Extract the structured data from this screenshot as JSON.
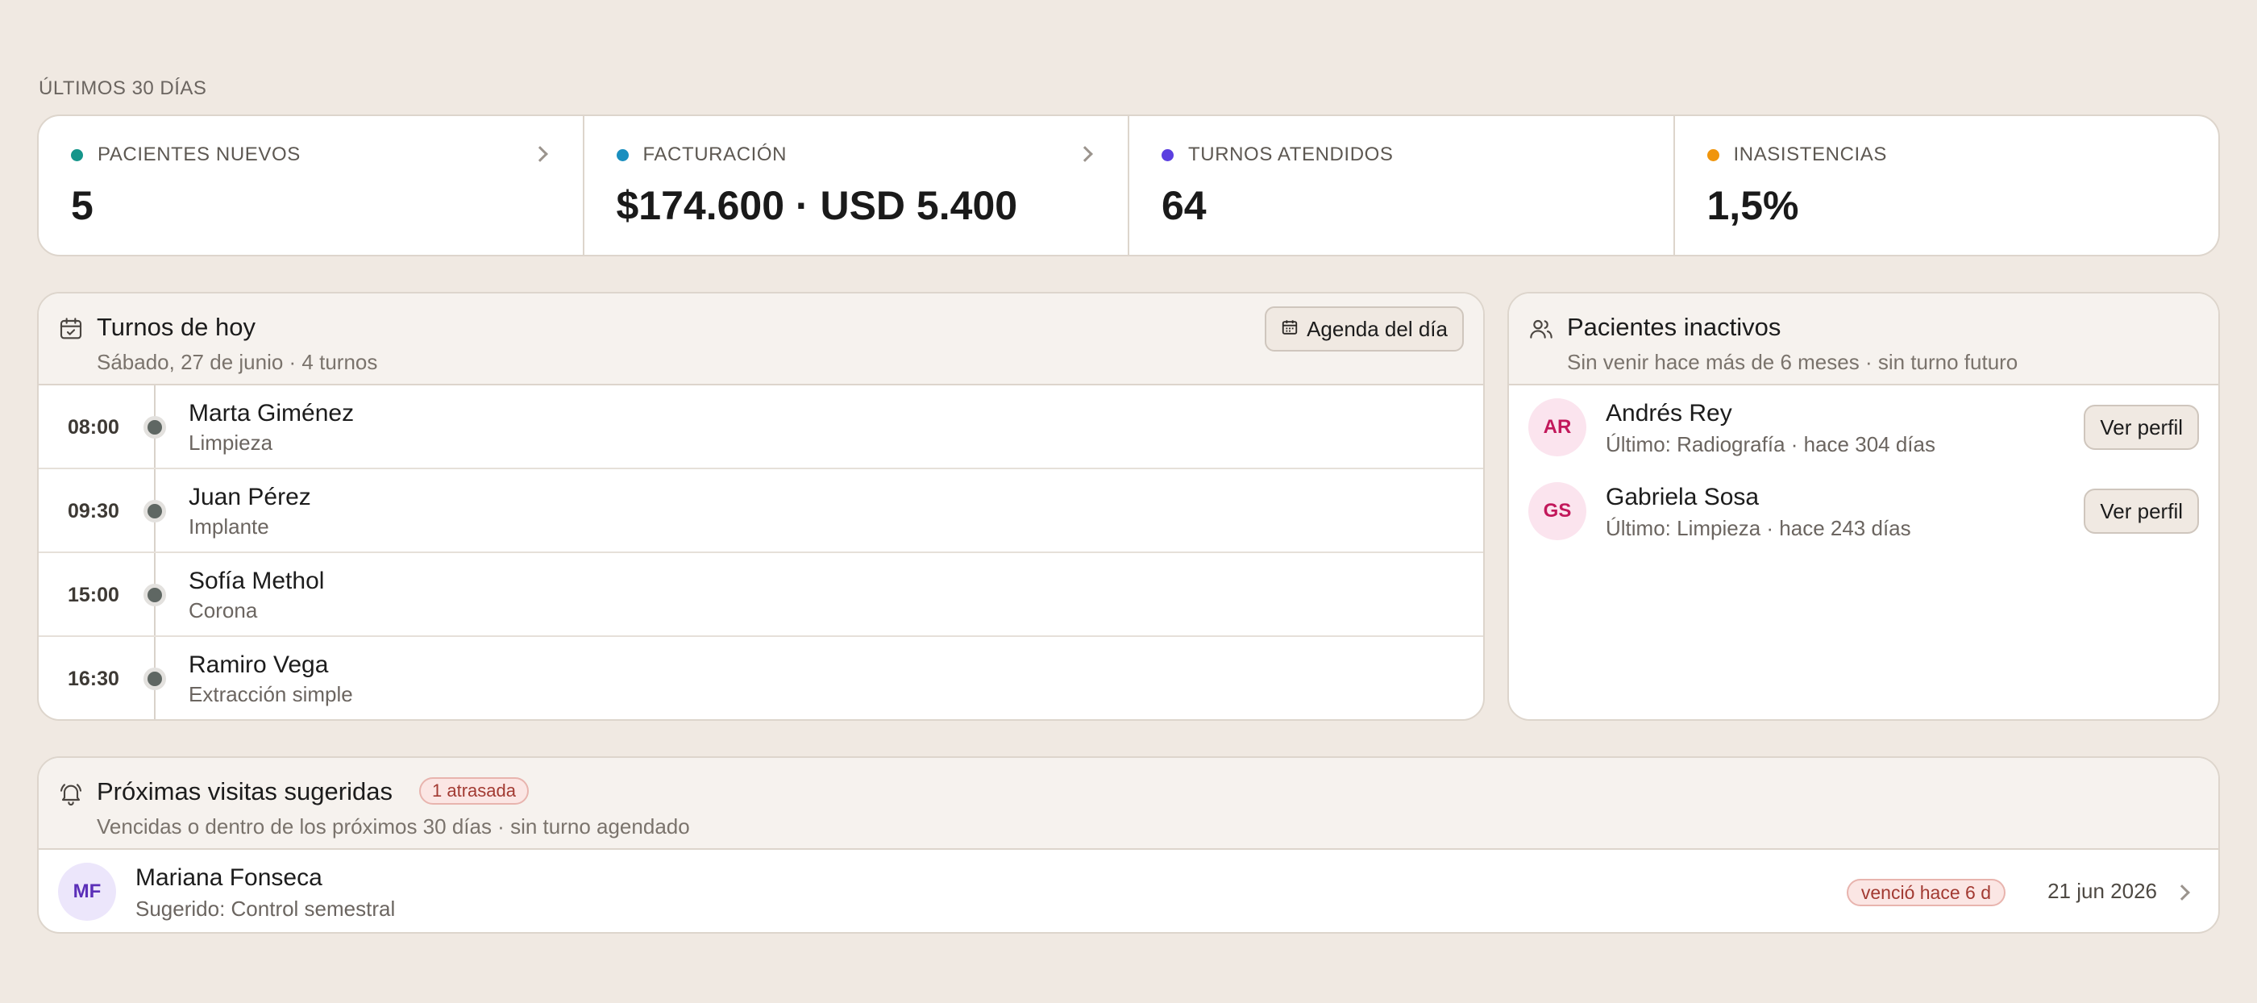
{
  "summary": {
    "period_label": "ÚLTIMOS 30 DÍAS",
    "kpis": [
      {
        "label": "PACIENTES NUEVOS",
        "value": "5",
        "dot_color": "#14958a"
      },
      {
        "label": "FACTURACIÓN",
        "value": "$174.600 · USD 5.400",
        "dot_color": "#1a8fbf"
      },
      {
        "label": "TURNOS ATENDIDOS",
        "value": "64",
        "dot_color": "#5b3fe0"
      },
      {
        "label": "INASISTENCIAS",
        "value": "1,5%",
        "dot_color": "#f0950c"
      }
    ]
  },
  "today": {
    "title": "Turnos de hoy",
    "subtitle": "Sábado, 27 de junio · 4 turnos",
    "agenda_button": "Agenda del día",
    "appointments": [
      {
        "time": "08:00",
        "patient": "Marta Giménez",
        "procedure": "Limpieza"
      },
      {
        "time": "09:30",
        "patient": "Juan Pérez",
        "procedure": "Implante"
      },
      {
        "time": "15:00",
        "patient": "Sofía Methol",
        "procedure": "Corona"
      },
      {
        "time": "16:30",
        "patient": "Ramiro Vega",
        "procedure": "Extracción simple"
      }
    ]
  },
  "inactive": {
    "title": "Pacientes inactivos",
    "subtitle": "Sin venir hace más de 6 meses · sin turno futuro",
    "patients": [
      {
        "initials": "AR",
        "name": "Andrés Rey",
        "detail": "Último: Radiografía · hace 304 días",
        "button": "Ver perfil"
      },
      {
        "initials": "GS",
        "name": "Gabriela Sosa",
        "detail": "Último: Limpieza · hace 243 días",
        "button": "Ver perfil"
      }
    ]
  },
  "suggested": {
    "title": "Próximas visitas sugeridas",
    "badge": "1 atrasada",
    "subtitle": "Vencidas o dentro de los próximos 30 días · sin turno agendado",
    "visits": [
      {
        "initials": "MF",
        "name": "Mariana Fonseca",
        "detail": "Sugerido: Control semestral",
        "status": "venció hace 6 d",
        "date": "21 jun 2026"
      }
    ]
  },
  "icons": {
    "calendar": "calendar-icon",
    "users": "users-icon",
    "bell": "bell-icon",
    "chevron": "chevron-right-icon"
  }
}
